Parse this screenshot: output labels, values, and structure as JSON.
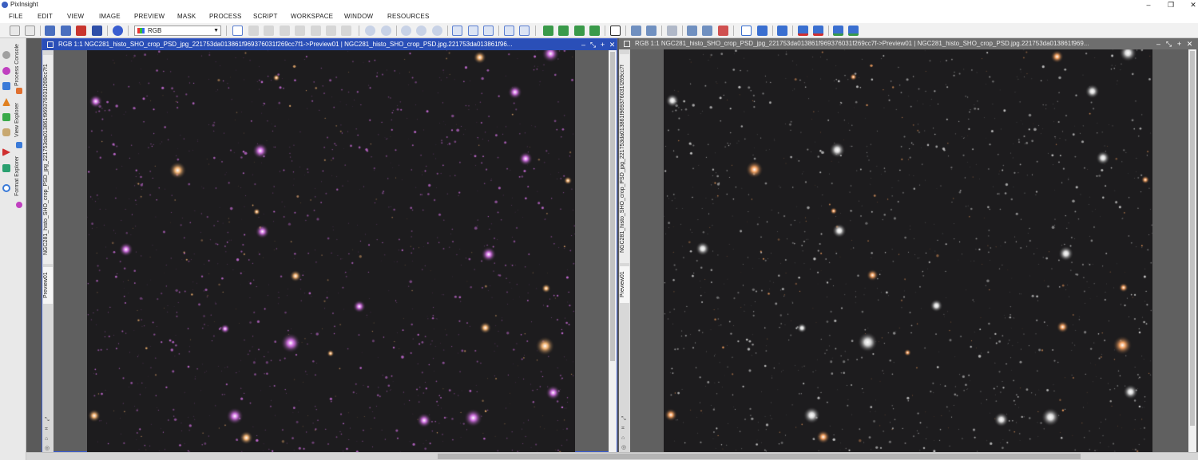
{
  "window": {
    "title": "PixInsight",
    "minimize_glyph": "–",
    "restore_glyph": "❐",
    "close_glyph": "✕"
  },
  "menu": [
    "FILE",
    "EDIT",
    "VIEW",
    "IMAGE",
    "PREVIEW",
    "MASK",
    "PROCESS",
    "SCRIPT",
    "WORKSPACE",
    "WINDOW",
    "RESOURCES"
  ],
  "toolbar": {
    "channel_select": "RGB",
    "icons": [
      "undo-icon",
      "redo-icon",
      "new-image-icon",
      "open-icon",
      "save-icon",
      "save-as-icon",
      "readout-icon",
      "channel-icon",
      "pan-icon",
      "fit-icon",
      "zoom-fit-icon",
      "move-icon",
      "move-all-icon",
      "select-icon",
      "pointer-icon",
      "zoom-in-icon",
      "zoom-out-icon",
      "zoom-1-icon",
      "zoom-2-icon",
      "zoom-3-icon",
      "preview-new-icon",
      "preview-edit-icon",
      "preview-delete-icon",
      "preview-crop-icon",
      "mask-show-icon",
      "mask-enable-icon",
      "mask-invert-icon",
      "mask-link-icon",
      "screen-icon",
      "screen-stf-icon",
      "screen-auto-icon",
      "screen-reset-icon",
      "display-icon",
      "display-blend-icon"
    ]
  },
  "sidebar": {
    "tabs": [
      "Process Console",
      "View Explorer",
      "Format Explorer"
    ],
    "icons": [
      "gear-icon",
      "process-icon",
      "image-icon",
      "star-icon",
      "cube-icon",
      "database-icon",
      "arrow-icon",
      "chart-icon",
      "target-icon"
    ]
  },
  "view_left": {
    "header": "RGB 1:1 NGC281_histo_SHO_crop_PSD_jpg_221753da013861f969376031f269cc7f1->Preview01 | NGC281_histo_SHO_crop_PSD.jpg.221753da013861f96...",
    "tab_name": "NGC281_histo_SHO_crop_PSD_jpg_221753da013861f969376031f269cc7f1",
    "preview_tab": "Preview01",
    "star_tint": "#d070e0",
    "bright_star_color": "#f0b070"
  },
  "view_right": {
    "header": "RGB 1:1 NGC281_histo_SHO_crop_PSD_jpg_221753da013861f969376031f269cc7f->Preview01 | NGC281_histo_SHO_crop_PSD.jpg.221753da013861f969...",
    "tab_name": "NGC281_histo_SHO_crop_PSD_jpg_221753da013861f969376031f269cc7f",
    "preview_tab": "Preview01",
    "star_tint": "#d8d8d8",
    "bright_star_color": "#f2a060"
  },
  "header_buttons": [
    "–",
    "⤡",
    "+",
    "✕"
  ]
}
